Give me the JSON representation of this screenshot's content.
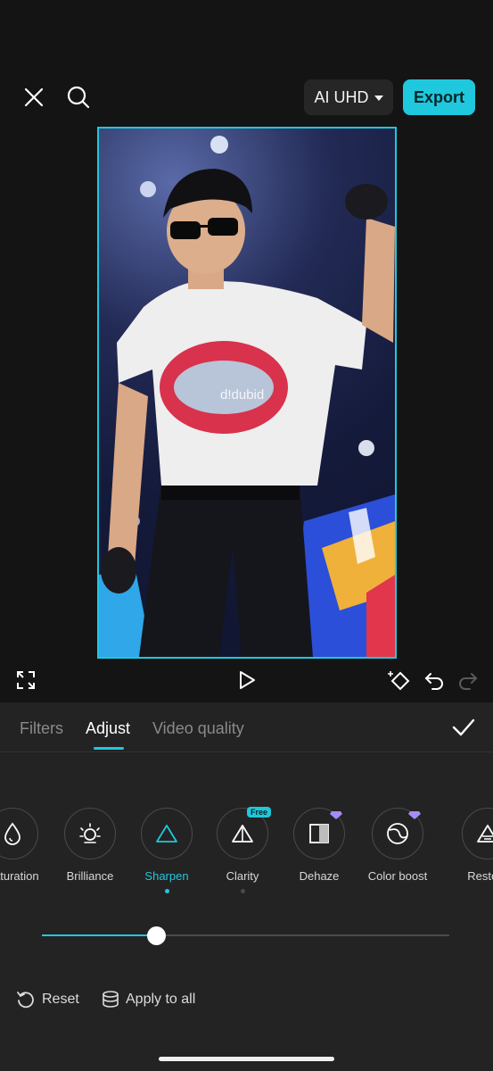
{
  "topbar": {
    "quality_label": "AI UHD",
    "export_label": "Export"
  },
  "preview": {
    "watermark": "d!dubid"
  },
  "tabs": [
    {
      "label": "Filters",
      "active": false
    },
    {
      "label": "Adjust",
      "active": true
    },
    {
      "label": "Video quality",
      "active": false
    }
  ],
  "tools": [
    {
      "label": "Saturation",
      "icon": "droplet-icon"
    },
    {
      "label": "Brilliance",
      "icon": "sun-icon"
    },
    {
      "label": "Sharpen",
      "icon": "triangle-icon",
      "active": true
    },
    {
      "label": "Clarity",
      "icon": "clarity-icon",
      "badge": "Free"
    },
    {
      "label": "Dehaze",
      "icon": "dehaze-icon",
      "premium": true
    },
    {
      "label": "Color boost",
      "icon": "color-boost-icon",
      "premium": true
    },
    {
      "label": "Restore",
      "icon": "restore-icon"
    }
  ],
  "slider": {
    "value_fraction": 0.28
  },
  "actions": {
    "reset_label": "Reset",
    "apply_all_label": "Apply to all"
  },
  "colors": {
    "accent": "#1fc8dc",
    "panel": "#232323",
    "background": "#141414"
  }
}
